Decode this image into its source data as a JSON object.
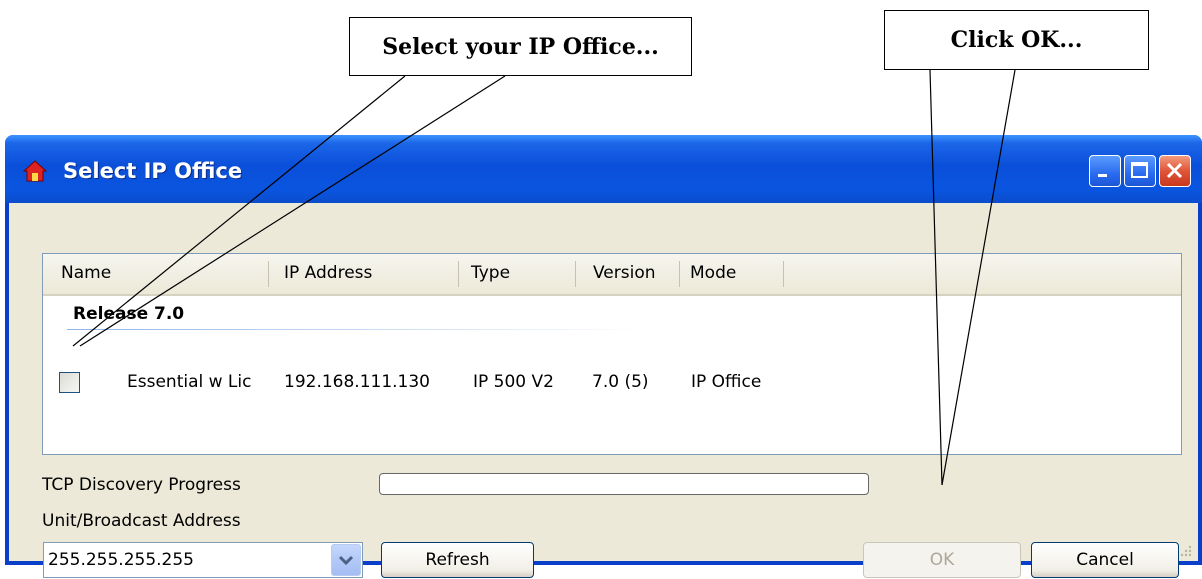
{
  "callouts": {
    "select": "Select your IP Office...",
    "ok": "Click OK..."
  },
  "window": {
    "title": "Select IP Office",
    "controls": [
      "minimize",
      "maximize",
      "close"
    ]
  },
  "table": {
    "columns": [
      "Name",
      "IP Address",
      "Type",
      "Version",
      "Mode"
    ],
    "group": "Release 7.0",
    "rows": [
      {
        "name": "Essential w Lic",
        "ip": "192.168.111.130",
        "type": "IP 500 V2",
        "version": "7.0 (5)",
        "mode": "IP Office",
        "checked": false
      }
    ]
  },
  "discovery": {
    "progress_label": "TCP Discovery Progress",
    "progress": 0,
    "address_label": "Unit/Broadcast Address",
    "address_value": "255.255.255.255"
  },
  "buttons": {
    "refresh": "Refresh",
    "ok": "OK",
    "cancel": "Cancel"
  },
  "colors": {
    "titlebar": "#0a4fd9",
    "close_button": "#e0553a",
    "dialog_bg": "#ece9d8"
  }
}
